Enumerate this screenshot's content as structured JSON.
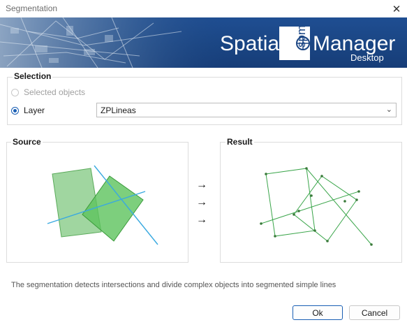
{
  "window": {
    "title": "Segmentation",
    "close_glyph": "✕"
  },
  "banner": {
    "brand_left": "Spatial",
    "brand_box": "spm",
    "brand_right": "Manager",
    "brand_sub": "Desktop"
  },
  "selection": {
    "group_label": "Selection",
    "option_selected_objects": "Selected objects",
    "option_layer": "Layer",
    "layer_value": "ZPLineas",
    "layer_selected": true
  },
  "source_panel": {
    "label": "Source"
  },
  "result_panel": {
    "label": "Result"
  },
  "arrows": [
    "→",
    "→",
    "→"
  ],
  "description": "The segmentation detects intersections and divide complex objects into segmented simple lines",
  "buttons": {
    "ok": "Ok",
    "cancel": "Cancel"
  },
  "colors": {
    "banner_blue": "#1a4583",
    "accent": "#1a5fb4",
    "green_fill": "#5fc25f",
    "green_line": "#3aa54a",
    "cyan_line": "#39a9e0"
  }
}
